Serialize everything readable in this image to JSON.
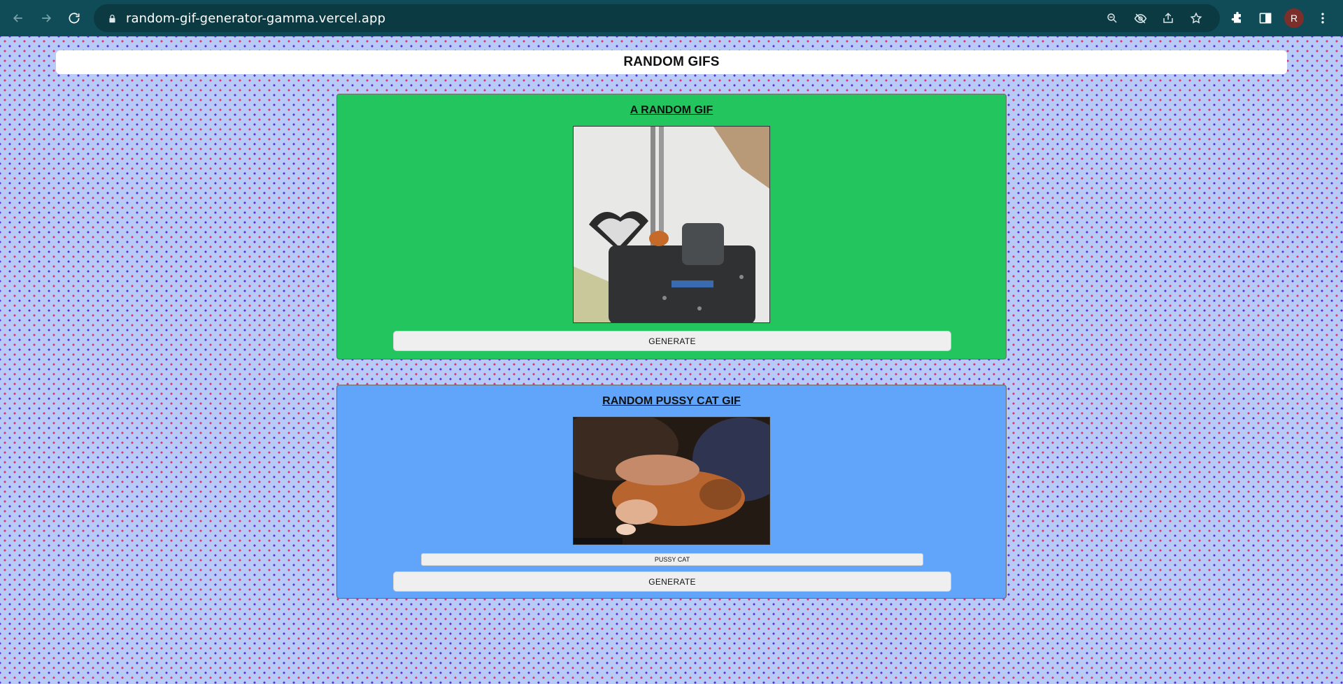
{
  "browser": {
    "url": "random-gif-generator-gamma.vercel.app",
    "profile_initial": "R",
    "icons": [
      "back-icon",
      "forward-icon",
      "reload-icon",
      "lock-icon",
      "zoom-icon",
      "eye-off-icon",
      "share-icon",
      "star-icon",
      "extensions-icon",
      "side-panel-icon",
      "menu-icon"
    ]
  },
  "header": {
    "title": "RANDOM GIFS"
  },
  "cards": [
    {
      "title": "A RANDOM GIF",
      "button_label": "GENERATE",
      "color": "#22c55e"
    },
    {
      "title": "RANDOM PUSSY CAT GIF",
      "tag_value": "PUSSY CAT",
      "button_label": "GENERATE",
      "color": "#60a5fa"
    }
  ],
  "colors": {
    "page_bg": "#b7cbf6",
    "dot_pink": "#e0307a",
    "dot_purple": "#5b2ee6",
    "chrome": "#0f4c57"
  }
}
